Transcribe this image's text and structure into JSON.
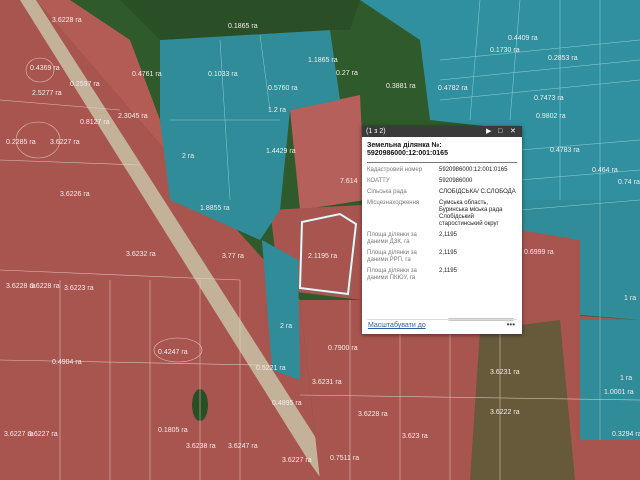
{
  "map": {
    "colors": {
      "parcel_red": "#a8554f",
      "parcel_red_light": "#b7645c",
      "parcel_teal": "#2f8c98",
      "parcel_teal_light": "#3fa0ad",
      "forest": "#2a4f26",
      "road": "#c9c2a6",
      "boundary": "#e8d8d6",
      "selection": "#d9fbff"
    },
    "labels": [
      "3.6228 га",
      "0.4369 га",
      "2.5277 га",
      "0.2597 га",
      "0.8127 га",
      "2.3045 га",
      "0.2285 га",
      "3.6227 га",
      "3.6226 га",
      "3.6232 га",
      "3.77 га",
      "3.6228 га",
      "3.6228 га",
      "3.6223 га",
      "0.4247 га",
      "0.4904 га",
      "3.6227 га",
      "3.6227 га",
      "0.1805 га",
      "3.6238 га",
      "3.6247 га",
      "3.6227 га",
      "0.7511 га",
      "3.6231 га",
      "3.6228 га",
      "3.623 га",
      "3.6222 га",
      "3.6231 га",
      "0.3294 га",
      "1.0001 га",
      "0.4895 га",
      "0.5221 га",
      "2 га",
      "2 га",
      "1.8855 га",
      "1.4429 га",
      "1.2 га",
      "0.5760 га",
      "0.4761 га",
      "0.1033 га",
      "0.1865 га",
      "1.1865 га",
      "0.3881 га",
      "0.27 га",
      "0.4782 га",
      "0.1730 га",
      "0.2853 га",
      "0.4409 га",
      "0.7473 га",
      "0.9802 га",
      "0.4783 га",
      "0.464 га",
      "0.74 га",
      "0.6999 га",
      "1 га",
      "1 га",
      "7.614",
      "2.1195 га",
      "0.7900 га"
    ]
  },
  "popup": {
    "counter": "(1 з 2)",
    "play_icon": "play-icon",
    "maximize_icon": "maximize-icon",
    "close_icon": "close-icon",
    "title_line1": "Земельна ділянка №:",
    "title_line2": "5920986000:12:001:0165",
    "fields": [
      {
        "key": "Кадастровий номер",
        "value": "5920986000:12:001:0165"
      },
      {
        "key": "КОАТТУ",
        "value": "5920986000"
      },
      {
        "key": "Сільська рада",
        "value": "СЛОБІДСЬКА/ С.СЛОБОДА"
      },
      {
        "key": "Місцезнаходження",
        "value": "Сумська область, Буринська міська рада Слобідський старостинський округ"
      },
      {
        "key": "Площа ділянки за даними ДЗК, га",
        "value": "2,1195"
      },
      {
        "key": "Площа ділянки за даними РРП, га",
        "value": "2,1195"
      },
      {
        "key": "Площа ділянки за даними ПКЮУ, га",
        "value": "2,1195"
      }
    ],
    "zoom_link": "Масштабувати до",
    "more": "•••"
  }
}
